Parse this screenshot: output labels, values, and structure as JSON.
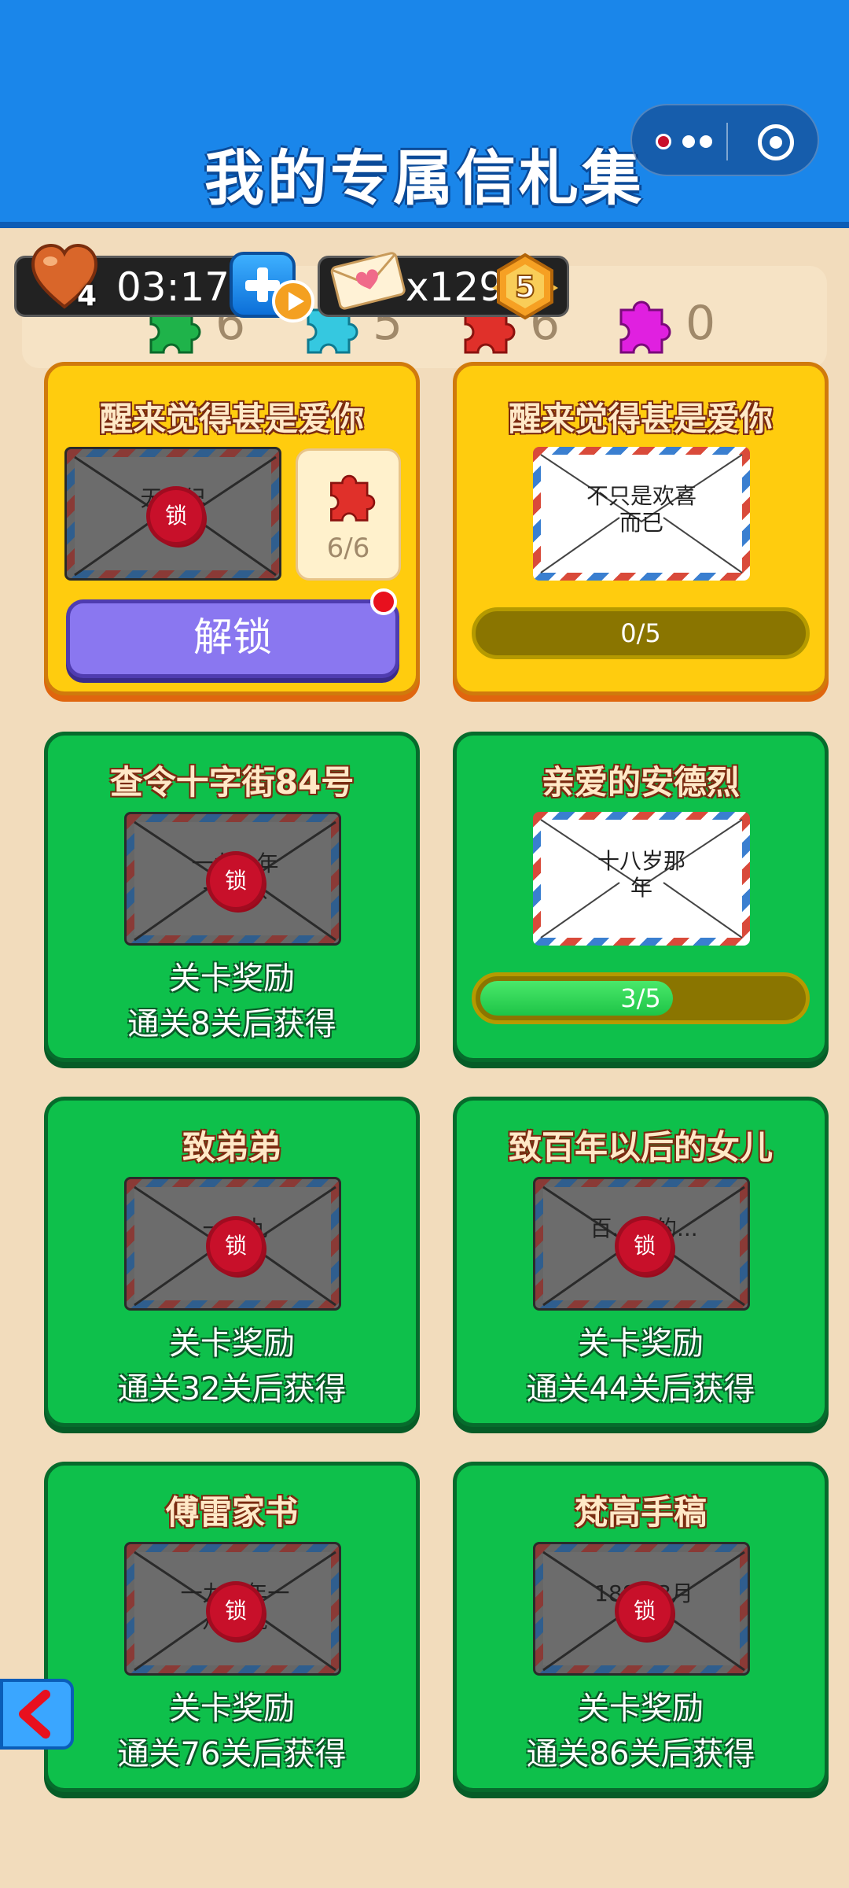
{
  "header": {
    "title": "我的专属信札集"
  },
  "hud": {
    "lives": "4",
    "timer": "03:17",
    "letters": "x129",
    "level": "5"
  },
  "puzzle_bar": {
    "counts": [
      "6",
      "5",
      "6",
      "0"
    ],
    "colors": [
      "#1fb34a",
      "#35c8e0",
      "#e0302a",
      "#e020e0"
    ]
  },
  "cards": {
    "top_left": {
      "title": "醒来觉得甚是爱你",
      "envelope_text": "无...纪",
      "seal": "锁",
      "pieces": "6/6",
      "button": "解锁"
    },
    "top_right": {
      "title": "醒来觉得甚是爱你",
      "envelope_text": "不只是欢喜而已",
      "progress": "0/5",
      "progress_value": 0
    },
    "c1": {
      "title": "查令十字街84号",
      "envelope_text": "一九...年十...八",
      "seal": "锁",
      "reward_line1": "关卡奖励",
      "reward_line2": "通关8关后获得"
    },
    "c2": {
      "title": "亲爱的安德烈",
      "envelope_text": "十八岁那年",
      "progress": "3/5",
      "progress_value": 0.6
    },
    "c3": {
      "title": "致弟弟",
      "envelope_text": "一...九",
      "seal": "锁",
      "reward_line1": "关卡奖励",
      "reward_line2": "通关32关后获得"
    },
    "c4": {
      "title": "致百年以后的女儿",
      "envelope_text": "百...后的...",
      "seal": "锁",
      "reward_line1": "关卡奖励",
      "reward_line2": "通关44关后获得"
    },
    "c5": {
      "title": "傅雷家书",
      "envelope_text": "一九...年一月...晚",
      "seal": "锁",
      "reward_line1": "关卡奖励",
      "reward_line2": "通关76关后获得"
    },
    "c6": {
      "title": "梵高手稿",
      "envelope_text": "188...3月",
      "seal": "锁",
      "reward_line1": "关卡奖励",
      "reward_line2": "通关86关后获得"
    }
  },
  "icons": {
    "heart": "heart-icon",
    "letter": "love-letter-icon",
    "back": "chevron-left-icon"
  }
}
